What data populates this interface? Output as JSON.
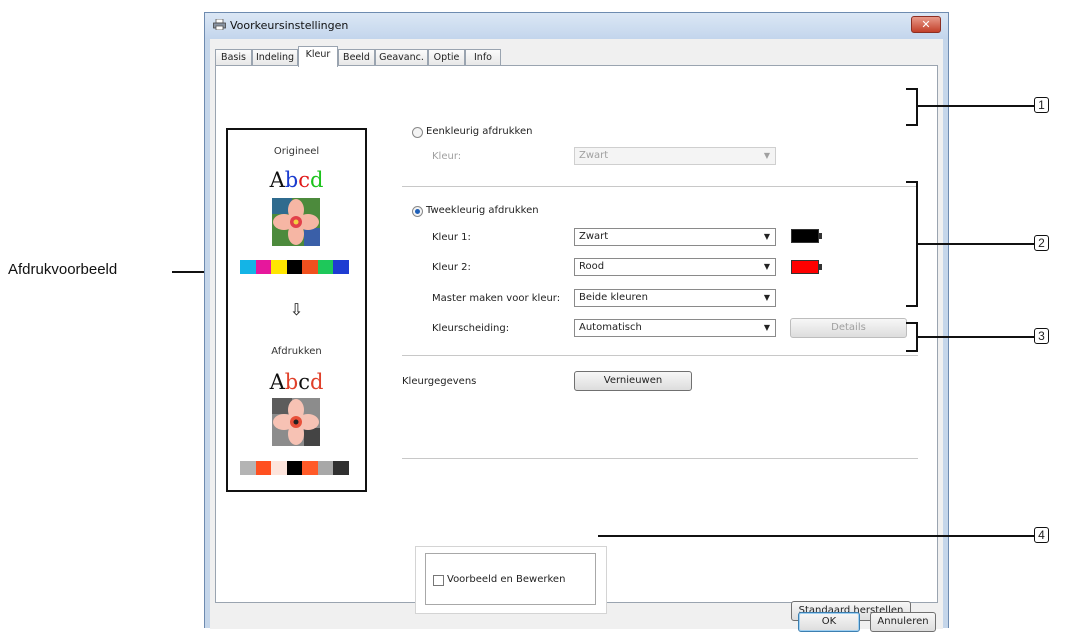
{
  "window": {
    "title": "Voorkeursinstellingen",
    "close_label": "✕"
  },
  "tabs": [
    {
      "label": "Basis"
    },
    {
      "label": "Indeling"
    },
    {
      "label": "Kleur"
    },
    {
      "label": "Beeld"
    },
    {
      "label": "Geavanc."
    },
    {
      "label": "Optie"
    },
    {
      "label": "Info"
    }
  ],
  "active_tab": "Kleur",
  "preview": {
    "original_label": "Origineel",
    "output_label": "Afdrukken",
    "sample_text": [
      "A",
      "b",
      "c",
      "d"
    ],
    "original_text_colors": [
      "#111111",
      "#1a3ccf",
      "#e01818",
      "#1cc31c"
    ],
    "output_text_colors": [
      "#111111",
      "#e0402a",
      "#111111",
      "#e0402a"
    ],
    "arrow": "⇩",
    "original_swatches": [
      "#14b4e6",
      "#e6179c",
      "#ffe600",
      "#000000",
      "#f0501e",
      "#1ec85a",
      "#1e3cd2"
    ],
    "output_swatches": [
      "#b4b4b4",
      "#ff5020",
      "#fde4dc",
      "#000000",
      "#ff5a28",
      "#a8a8a8",
      "#303030"
    ]
  },
  "mono": {
    "radio_label": "Eenkleurig afdrukken",
    "selected": false,
    "color_label": "Kleur:",
    "color_value": "Zwart"
  },
  "two_color": {
    "radio_label": "Tweekleurig afdrukken",
    "selected": true,
    "color1_label": "Kleur 1:",
    "color1_value": "Zwart",
    "color1_swatch": "#000000",
    "color2_label": "Kleur 2:",
    "color2_value": "Rood",
    "color2_swatch": "#ff0000",
    "master_label": "Master maken voor kleur:",
    "master_value": "Beide kleuren",
    "separation_label": "Kleurscheiding:",
    "separation_value": "Automatisch",
    "details_label": "Details"
  },
  "color_data": {
    "label": "Kleurgegevens",
    "button_label": "Vernieuwen"
  },
  "preview_edit": {
    "checkbox_label": "Voorbeeld en Bewerken",
    "checked": false
  },
  "restore_label": "Standaard herstellen",
  "ok_label": "OK",
  "cancel_label": "Annuleren",
  "annotations": {
    "side_label": "Afdrukvoorbeeld",
    "callouts": [
      "1",
      "2",
      "3",
      "4"
    ]
  },
  "colors": {
    "accent": "#1e5fb8",
    "title_bar": "#c5d6ea",
    "close_button": "#c2402a"
  }
}
